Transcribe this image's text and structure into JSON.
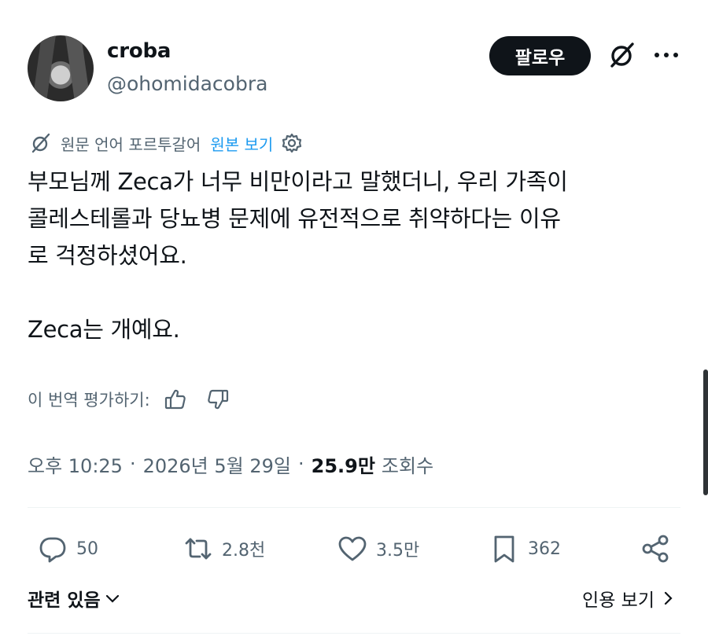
{
  "author": {
    "display_name": "croba",
    "handle": "@ohomidacobra"
  },
  "header": {
    "follow_label": "팔로우",
    "grok_icon": "grok-icon",
    "more_icon": "more-icon"
  },
  "translation": {
    "notice": "원문 언어 포르투갈어",
    "show_original_label": "원본 보기"
  },
  "tweet": {
    "text": "부모님께 Zeca가 너무 비만이라고 말했더니, 우리 가족이\n콜레스테롤과 당뇨병 문제에 유전적으로 취약하다는 이유\n로 걱정하셨어요.\n\nZeca는 개예요."
  },
  "rate_translation": {
    "label": "이 번역 평가하기:"
  },
  "meta": {
    "time": "오후 10:25",
    "separator": "·",
    "date": "2026년 5월 29일",
    "views_count": "25.9만",
    "views_label": "조회수"
  },
  "stats": {
    "replies": "50",
    "reposts": "2.8천",
    "likes": "3.5만",
    "bookmarks": "362"
  },
  "footer": {
    "related_label": "관련 있음",
    "quotes_label": "인용 보기"
  },
  "colors": {
    "primary_text": "#0f1419",
    "secondary_text": "#536471",
    "link": "#1d9bf0",
    "button_bg": "#0f1419"
  }
}
